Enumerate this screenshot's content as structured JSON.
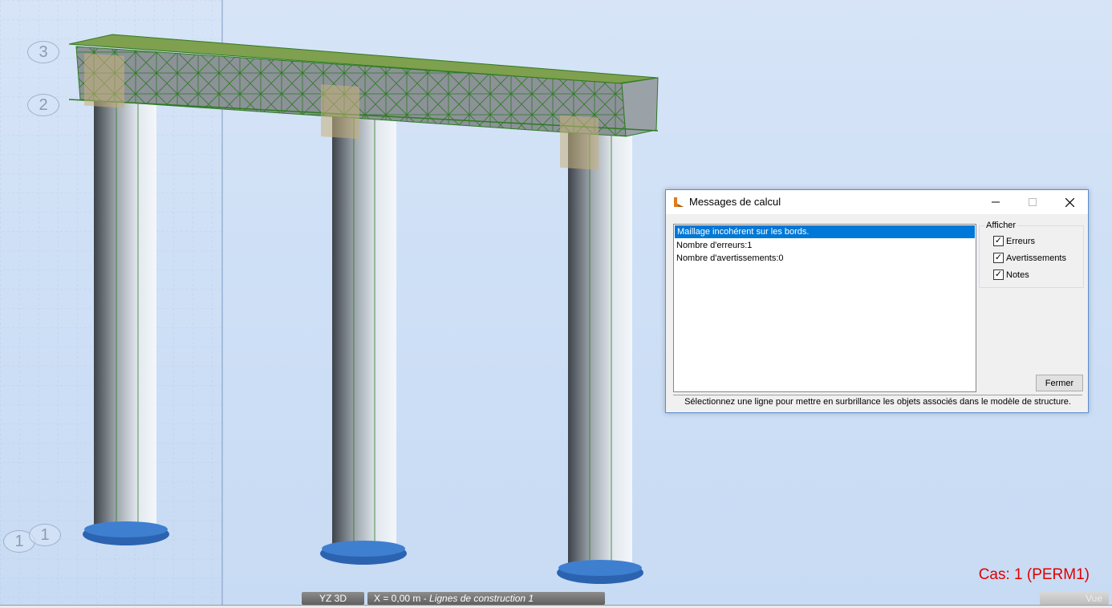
{
  "grid_labels": {
    "label_3": "3",
    "label_2": "2",
    "label_1a": "1",
    "label_1b": "1"
  },
  "case_label": "Cas: 1 (PERM1)",
  "statusbar": {
    "view_label": "YZ 3D",
    "coord_prefix": "X = 0,00 m - ",
    "coord_italic": "Lignes de construction 1",
    "right_label": "Vue"
  },
  "dialog": {
    "title": "Messages de calcul",
    "messages": [
      "Maillage incohérent sur les bords.",
      "Nombre d'erreurs:1",
      "Nombre d'avertissements:0"
    ],
    "afficher_label": "Afficher",
    "checkboxes": {
      "erreurs": "Erreurs",
      "avertissements": "Avertissements",
      "notes": "Notes"
    },
    "fermer_label": "Fermer",
    "hint": "Sélectionnez une ligne pour mettre en surbrillance les objets associés dans le modèle de structure."
  },
  "colors": {
    "accent_selection": "#0078d7",
    "case_label": "#e00000",
    "mesh_green": "#2e7a22",
    "column_fill": "#9aa3ab",
    "footing_blue": "#2c63b0"
  }
}
